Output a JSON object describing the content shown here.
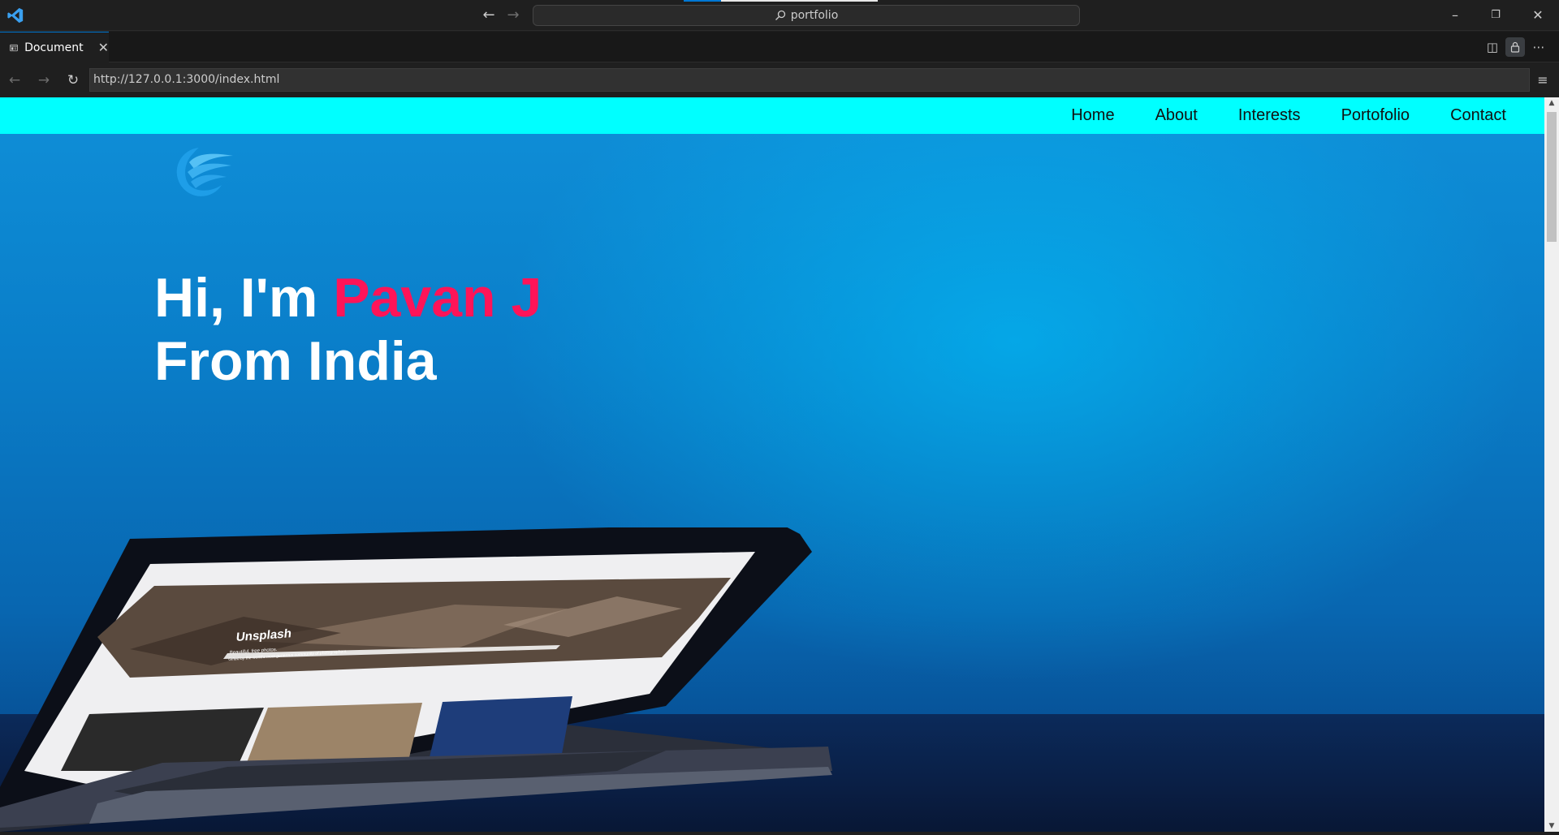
{
  "titlebar": {
    "search_text": "portfolio",
    "back_icon": "arrow-left-icon",
    "forward_icon": "arrow-right-icon",
    "minimize_icon": "minimize-icon",
    "restore_icon": "restore-icon",
    "close_icon": "close-icon"
  },
  "tab": {
    "label": "Document",
    "icon": "preview-icon",
    "close_icon": "close-icon"
  },
  "editor_actions": [
    "split-editor-icon",
    "lock-icon",
    "more-actions-icon"
  ],
  "browser": {
    "url": "http://127.0.0.1:3000/index.html",
    "back_icon": "arrow-left-icon",
    "forward_icon": "arrow-right-icon",
    "reload_icon": "reload-icon",
    "menu_icon": "menu-icon"
  },
  "site": {
    "nav": [
      "Home",
      "About",
      "Interests",
      "Portofolio",
      "Contact"
    ],
    "hero": {
      "greeting": "Hi, I'm ",
      "name": "Pavan J",
      "line2": "From India"
    },
    "logo_icon": "wave-logo-icon",
    "laptop_screen_title": "Unsplash",
    "laptop_screen_subtitle": "Beautiful, free photos.",
    "laptop_screen_subtitle2": "Gifted by the world's most generous community of photographers."
  },
  "colors": {
    "nav_bg": "#00ffff",
    "hero_name": "#ff1458",
    "accent": "#0078d4"
  }
}
